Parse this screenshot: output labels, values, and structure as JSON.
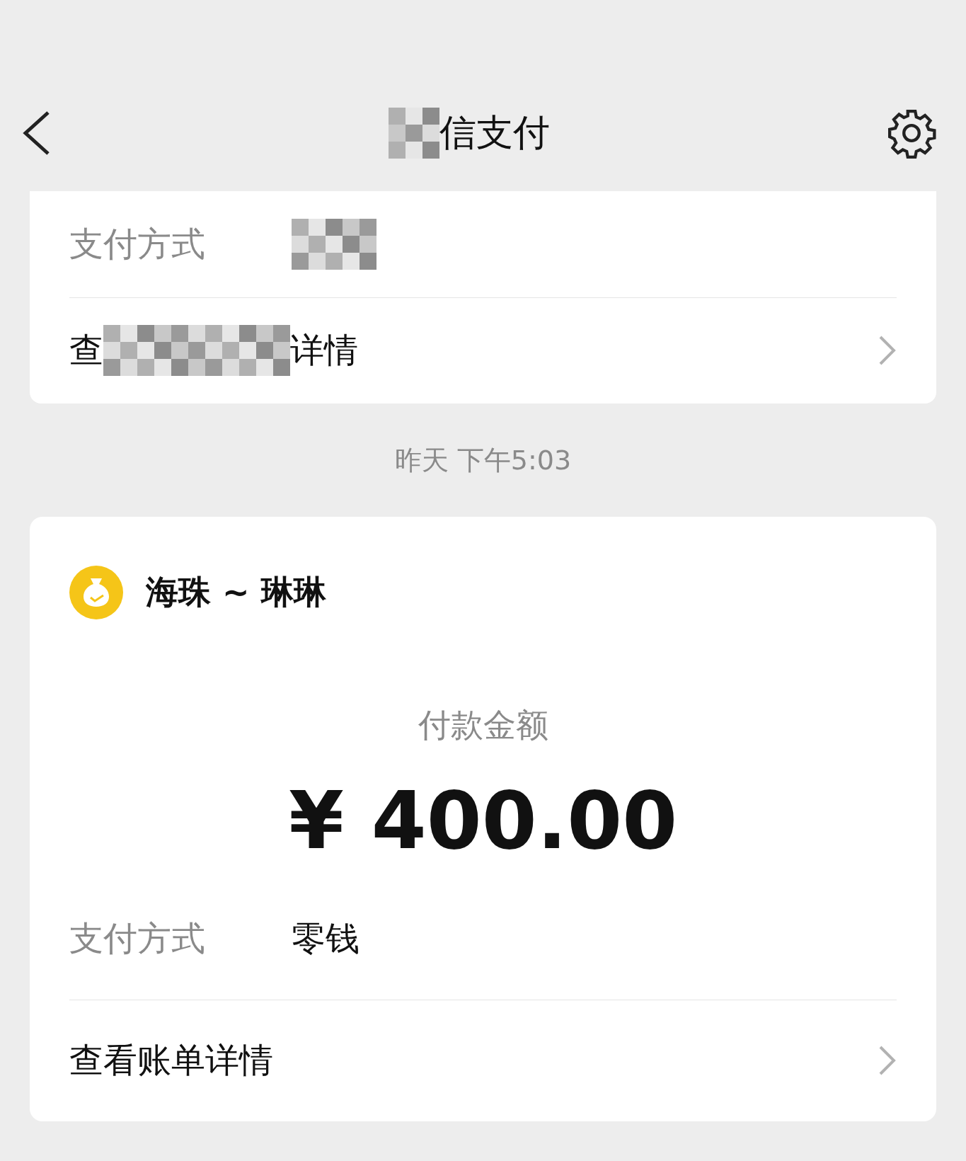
{
  "header": {
    "title": "信支付"
  },
  "previous_card": {
    "payment_label": "支付方式",
    "link_start": "查",
    "link_end": "详情"
  },
  "timestamp": "昨天 下午5:03",
  "payment_card": {
    "merchant": "海珠 ~ 琳琳",
    "amount_label": "付款金额",
    "amount": "¥ 400.00",
    "payment_label": "支付方式",
    "payment_value": "零钱",
    "link": "查看账单详情"
  }
}
